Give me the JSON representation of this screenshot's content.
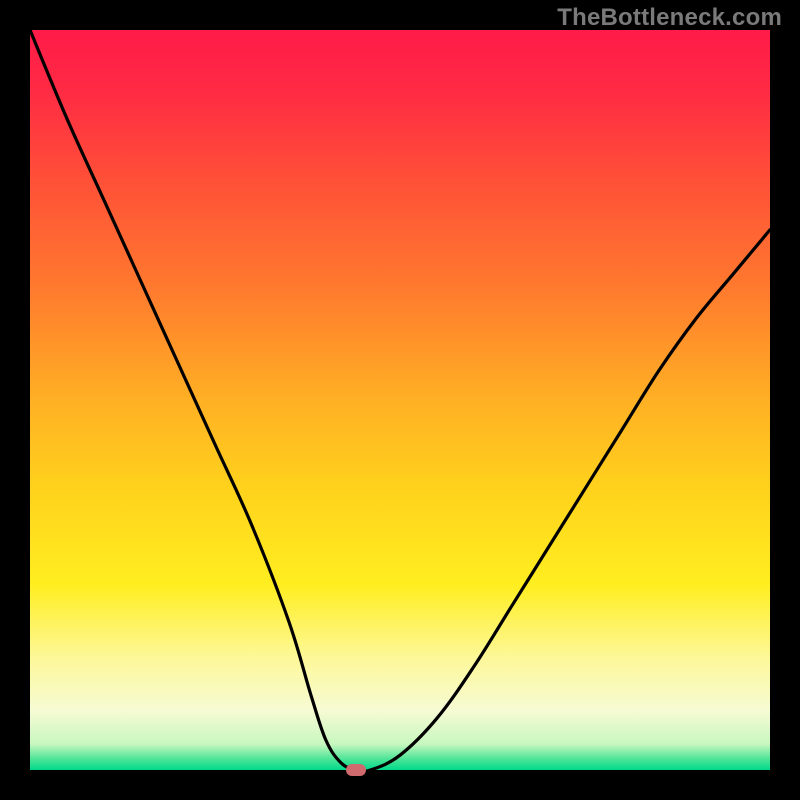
{
  "watermark": "TheBottleneck.com",
  "gradient": {
    "stops": [
      {
        "offset": 0.0,
        "color": "#ff1b48"
      },
      {
        "offset": 0.08,
        "color": "#ff2a44"
      },
      {
        "offset": 0.2,
        "color": "#ff4f38"
      },
      {
        "offset": 0.35,
        "color": "#ff7a2e"
      },
      {
        "offset": 0.5,
        "color": "#ffb024"
      },
      {
        "offset": 0.62,
        "color": "#ffd21c"
      },
      {
        "offset": 0.75,
        "color": "#ffee20"
      },
      {
        "offset": 0.85,
        "color": "#fdf89a"
      },
      {
        "offset": 0.92,
        "color": "#f6fbd4"
      },
      {
        "offset": 0.965,
        "color": "#c8f7bf"
      },
      {
        "offset": 0.985,
        "color": "#4de597"
      },
      {
        "offset": 1.0,
        "color": "#00d98a"
      }
    ]
  },
  "chart_data": {
    "type": "line",
    "title": "",
    "xlabel": "",
    "ylabel": "",
    "xlim": [
      0,
      100
    ],
    "ylim": [
      0,
      100
    ],
    "series": [
      {
        "name": "curve",
        "x": [
          0,
          5,
          10,
          15,
          20,
          25,
          30,
          35,
          38,
          40,
          42,
          44,
          46,
          50,
          55,
          60,
          65,
          70,
          75,
          80,
          85,
          90,
          95,
          100
        ],
        "values": [
          100,
          88,
          77,
          66,
          55,
          44,
          33,
          20,
          10,
          4,
          1,
          0,
          0,
          2,
          7,
          14,
          22,
          30,
          38,
          46,
          54,
          61,
          67,
          73
        ]
      }
    ],
    "marker": {
      "x": 44,
      "y": 0
    }
  }
}
